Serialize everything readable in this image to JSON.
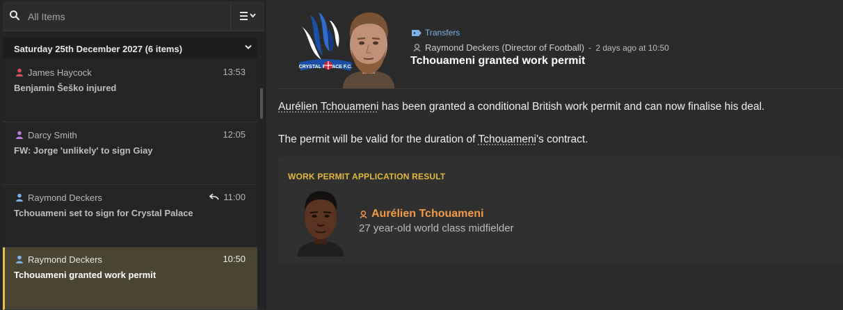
{
  "search": {
    "placeholder": "All Items"
  },
  "list": {
    "date_header": "Saturday 25th December 2027 (6 items)",
    "items": [
      {
        "sender": "James Haycock",
        "time": "13:53",
        "subject": "Benjamin Šeško injured",
        "icon_color": "#e0505a"
      },
      {
        "sender": "Darcy Smith",
        "time": "12:05",
        "subject": "FW: Jorge 'unlikely' to sign Giay",
        "icon_color": "#b880d8"
      },
      {
        "sender": "Raymond Deckers",
        "time": "11:00",
        "subject": "Tchouameni set to sign for Crystal Palace",
        "icon_color": "#7db2e8"
      },
      {
        "sender": "Raymond Deckers",
        "time": "10:50",
        "subject": "Tchouameni granted work permit",
        "icon_color": "#7db2e8"
      }
    ]
  },
  "message": {
    "category": "Transfers",
    "from": "Raymond Deckers (Director of Football)",
    "separator": "-",
    "when": "2 days ago at 10:50",
    "title": "Tchouameni granted work permit",
    "para1_link": "Aurélien Tchouameni",
    "para1_rest": " has been granted a conditional British work permit and can now finalise his deal.",
    "para2_pre": "The permit will be valid for the duration of ",
    "para2_link": "Tchouameni",
    "para2_post": "'s contract.",
    "card": {
      "title": "WORK PERMIT APPLICATION RESULT",
      "player_name": "Aurélien Tchouameni",
      "player_desc": "27 year-old world class midfielder"
    }
  },
  "colors": {
    "accent_gold": "#e5c24a",
    "link_blue": "#7fb2e6",
    "player_orange": "#f19a48",
    "selected_bg": "#4a4532"
  },
  "icons": [
    "search-icon",
    "filter-menu-icon",
    "chevron-down-icon",
    "person-icon",
    "reply-icon",
    "tag-icon",
    "club-crest-icon"
  ]
}
